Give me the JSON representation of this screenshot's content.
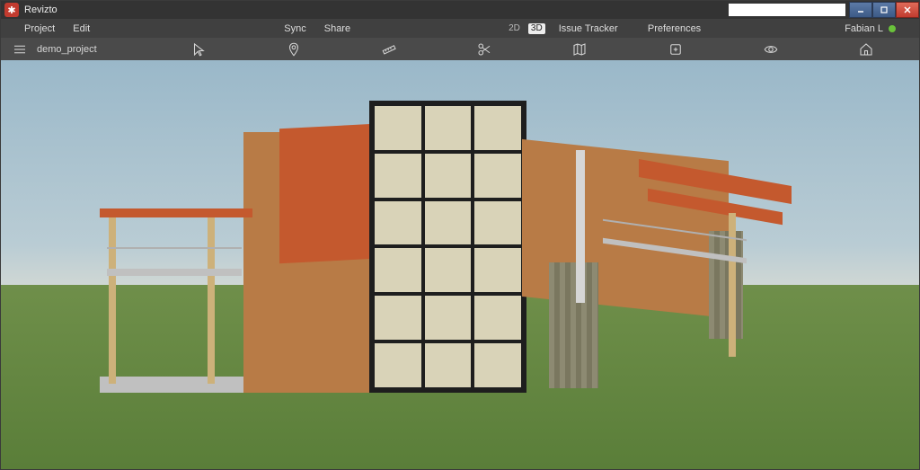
{
  "app": {
    "title": "Revizto"
  },
  "search": {
    "placeholder": ""
  },
  "menubar": {
    "project": "Project",
    "edit": "Edit",
    "sync": "Sync",
    "share": "Share",
    "view_2d": "2D",
    "view_3d": "3D",
    "issue_tracker": "Issue Tracker",
    "preferences": "Preferences"
  },
  "user": {
    "name": "Fabian L",
    "status_color": "#6ac23b"
  },
  "project": {
    "name": "demo_project"
  },
  "toolbar_icons": [
    "hamburger-icon",
    "cursor-icon",
    "location-pin-icon",
    "ruler-icon",
    "section-cut-icon",
    "map-icon",
    "add-issue-icon",
    "visibility-icon",
    "home-icon"
  ]
}
